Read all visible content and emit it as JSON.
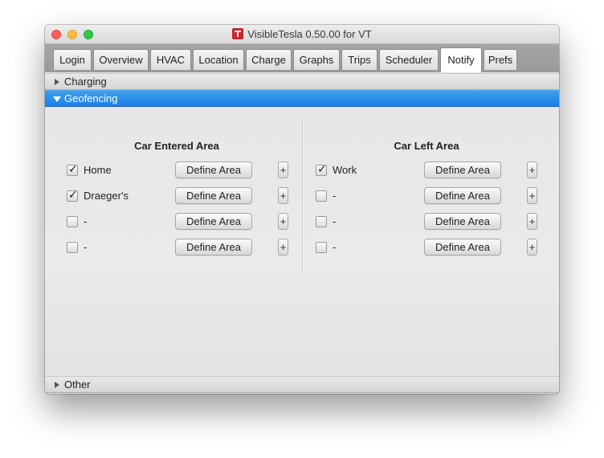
{
  "window": {
    "title": "VisibleTesla 0.50.00 for VT",
    "app_icon": "tesla-logo-icon"
  },
  "tabs": [
    {
      "label": "Login",
      "active": false
    },
    {
      "label": "Overview",
      "active": false
    },
    {
      "label": "HVAC",
      "active": false
    },
    {
      "label": "Location",
      "active": false
    },
    {
      "label": "Charge",
      "active": false
    },
    {
      "label": "Graphs",
      "active": false
    },
    {
      "label": "Trips",
      "active": false
    },
    {
      "label": "Scheduler",
      "active": false
    },
    {
      "label": "Notify",
      "active": true
    },
    {
      "label": "Prefs",
      "active": false
    }
  ],
  "sections": {
    "charging": {
      "label": "Charging",
      "expanded": false
    },
    "geofencing": {
      "label": "Geofencing",
      "expanded": true
    },
    "other": {
      "label": "Other",
      "expanded": false
    }
  },
  "geofencing": {
    "entered": {
      "title": "Car Entered Area",
      "rows": [
        {
          "checked": true,
          "label": "Home",
          "button": "Define Area",
          "plus": "+"
        },
        {
          "checked": true,
          "label": "Draeger's",
          "button": "Define Area",
          "plus": "+"
        },
        {
          "checked": false,
          "label": "-",
          "button": "Define Area",
          "plus": "+"
        },
        {
          "checked": false,
          "label": "-",
          "button": "Define Area",
          "plus": "+"
        }
      ]
    },
    "left": {
      "title": "Car Left Area",
      "rows": [
        {
          "checked": true,
          "label": "Work",
          "button": "Define Area",
          "plus": "+"
        },
        {
          "checked": false,
          "label": "-",
          "button": "Define Area",
          "plus": "+"
        },
        {
          "checked": false,
          "label": "-",
          "button": "Define Area",
          "plus": "+"
        },
        {
          "checked": false,
          "label": "-",
          "button": "Define Area",
          "plus": "+"
        }
      ]
    }
  },
  "colors": {
    "selection": "#1b7fe6",
    "close": "#fc605b",
    "minimize": "#fdbc40",
    "maximize": "#34c84a",
    "app_icon": "#c8252c"
  }
}
